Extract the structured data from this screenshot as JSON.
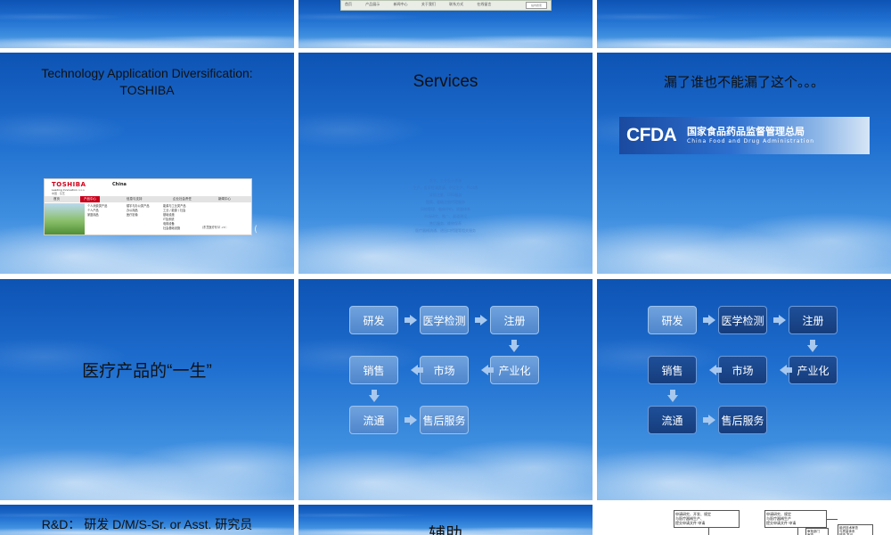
{
  "slides": {
    "s1": {},
    "s2": {
      "menu_items": [
        "首页",
        "产品展示",
        "新闻中心",
        "关于我们",
        "联系方式",
        "在线留言"
      ],
      "search_label": "站内搜索"
    },
    "s3": {},
    "s4": {
      "title": "Technology Application Diversification:\nTOSHIBA",
      "brand": "TOSHIBA",
      "tagline": "Leading Innovation >>>",
      "region": "China",
      "sub_region": "中国 · 东芝",
      "nav": [
        "首页",
        "产品中心",
        "信息与支持",
        "企业社会责任",
        "新闻中心"
      ],
      "col1": [
        "个人消费类产品",
        "个人产品",
        "家庭用品"
      ],
      "col2": [
        "楼宇与办公类产品",
        "办公用品",
        "医疗影像"
      ],
      "col3": [
        "能源与工业类产品",
        "工业 / 能源 / 社会",
        "基础设施",
        "IT及系统",
        "电梯设备",
        "社会基础设施"
      ],
      "overlay": "医疗产品 (",
      "ext": "（东芝医疗系统 >>）"
    },
    "s5": {
      "title": "Services",
      "faint_lines": [
        "医学、工业设计资源",
        "生产、医学检测资源、中试生产、Pilot线",
        "试验注册、CRO服务",
        "国家、省级注册代理服务",
        "风险管理、临床评价、质量体系",
        "市场研究、推广、渠道建设",
        "售后服务、维修保养",
        "医疗器械流通、进出口代理等相关服务"
      ]
    },
    "s6": {
      "title": "漏了谁也不能漏了这个。。。",
      "logo_acronym": "CFDA",
      "logo_cn": "国家食品药品监督管理总局",
      "logo_en": "China Food and Drug Administration"
    },
    "s7": {
      "title": "医疗产品的“一生”"
    },
    "s8": {
      "boxes": {
        "yanfa": "研发",
        "jiance": "医学检测",
        "zhuce": "注册",
        "chanye": "产业化",
        "shichang": "市场",
        "xiaoshou": "销售",
        "liutong": "流通",
        "shouhou": "售后服务"
      }
    },
    "s9": {
      "boxes": {
        "yanfa": "研发",
        "jiance": "医学检测",
        "zhuce": "注册",
        "chanye": "产业化",
        "shichang": "市场",
        "xiaoshou": "销售",
        "liutong": "流通",
        "shouhou": "售后服务"
      }
    },
    "s10": {
      "title": "R&D： 研发 D/M/S-Sr. or Asst. 研究员"
    },
    "s11": {
      "title": "辅助"
    },
    "s12": {
      "box1": "申请研究、开发、规定 \n与医疗器械生产、\n提交申请文件 申请",
      "box2": "申请研究、规定\n与医疗器械生产\n提交申请文件 申请",
      "box3": "审批部门\n审查",
      "box4": "组织技术审查\n与质量体系\n核查 发证"
    }
  }
}
